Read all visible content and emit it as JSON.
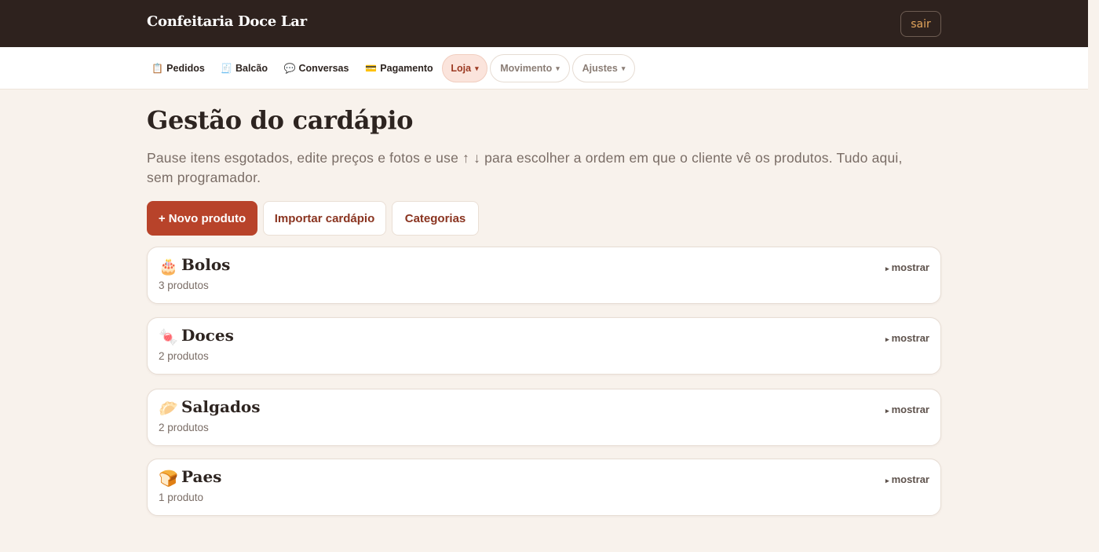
{
  "header": {
    "brand": "Confeitaria Doce Lar",
    "logout_label": "sair"
  },
  "nav": {
    "items": [
      {
        "icon": "📋",
        "icon_name": "clipboard-icon",
        "label": "Pedidos"
      },
      {
        "icon": "🧾",
        "icon_name": "receipt-icon",
        "label": "Balcão"
      },
      {
        "icon": "💬",
        "icon_name": "speech-bubble-icon",
        "label": "Conversas"
      },
      {
        "icon": "💳",
        "icon_name": "credit-card-icon",
        "label": "Pagamento"
      }
    ],
    "dropdowns": [
      {
        "label": "Loja",
        "caret": "▾",
        "active": true
      },
      {
        "label": "Movimento",
        "caret": "▾",
        "active": false
      },
      {
        "label": "Ajustes",
        "caret": "▾",
        "active": false
      }
    ]
  },
  "main": {
    "title": "Gestão do cardápio",
    "description": "Pause itens esgotados, edite preços e fotos e use ↑ ↓ para escolher a ordem em que o cliente vê os produtos. Tudo aqui, sem programador.",
    "actions": {
      "new_product": "+ Novo produto",
      "import_menu": "Importar cardápio",
      "categories": "Categorias"
    },
    "categories": [
      {
        "emoji": "🎂",
        "icon_name": "cake-icon",
        "name": "Bolos",
        "count": "3 produtos",
        "toggle": "mostrar"
      },
      {
        "emoji": "🍬",
        "icon_name": "candy-icon",
        "name": "Doces",
        "count": "2 produtos",
        "toggle": "mostrar"
      },
      {
        "emoji": "🥟",
        "icon_name": "dumpling-icon",
        "name": "Salgados",
        "count": "2 produtos",
        "toggle": "mostrar"
      },
      {
        "emoji": "🍞",
        "icon_name": "bread-icon",
        "name": "Paes",
        "count": "1 produto",
        "toggle": "mostrar"
      }
    ]
  },
  "colors": {
    "header_bg": "#2e221e",
    "page_bg": "#f8f2ec",
    "accent": "#b8432a",
    "accent_text": "#8a3420",
    "active_pill_bg": "#fbe4dc",
    "logout_text": "#e3a55c"
  }
}
